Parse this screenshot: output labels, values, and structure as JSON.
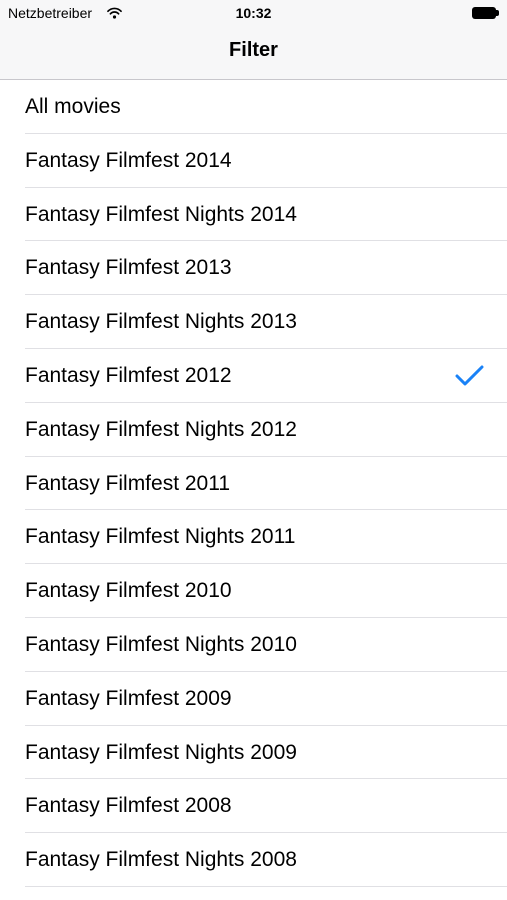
{
  "status_bar": {
    "carrier": "Netzbetreiber",
    "time": "10:32",
    "icons": [
      "wifi-icon",
      "battery-icon"
    ]
  },
  "nav": {
    "title": "Filter"
  },
  "accent_color": "#1a82f7",
  "filters": [
    {
      "label": "All movies",
      "selected": false
    },
    {
      "label": "Fantasy Filmfest 2014",
      "selected": false
    },
    {
      "label": "Fantasy Filmfest Nights 2014",
      "selected": false
    },
    {
      "label": "Fantasy Filmfest 2013",
      "selected": false
    },
    {
      "label": "Fantasy Filmfest Nights 2013",
      "selected": false
    },
    {
      "label": "Fantasy Filmfest 2012",
      "selected": true
    },
    {
      "label": "Fantasy Filmfest Nights 2012",
      "selected": false
    },
    {
      "label": "Fantasy Filmfest 2011",
      "selected": false
    },
    {
      "label": "Fantasy Filmfest Nights 2011",
      "selected": false
    },
    {
      "label": "Fantasy Filmfest 2010",
      "selected": false
    },
    {
      "label": "Fantasy Filmfest Nights 2010",
      "selected": false
    },
    {
      "label": "Fantasy Filmfest 2009",
      "selected": false
    },
    {
      "label": "Fantasy Filmfest Nights 2009",
      "selected": false
    },
    {
      "label": "Fantasy Filmfest 2008",
      "selected": false
    },
    {
      "label": "Fantasy Filmfest Nights 2008",
      "selected": false
    }
  ]
}
